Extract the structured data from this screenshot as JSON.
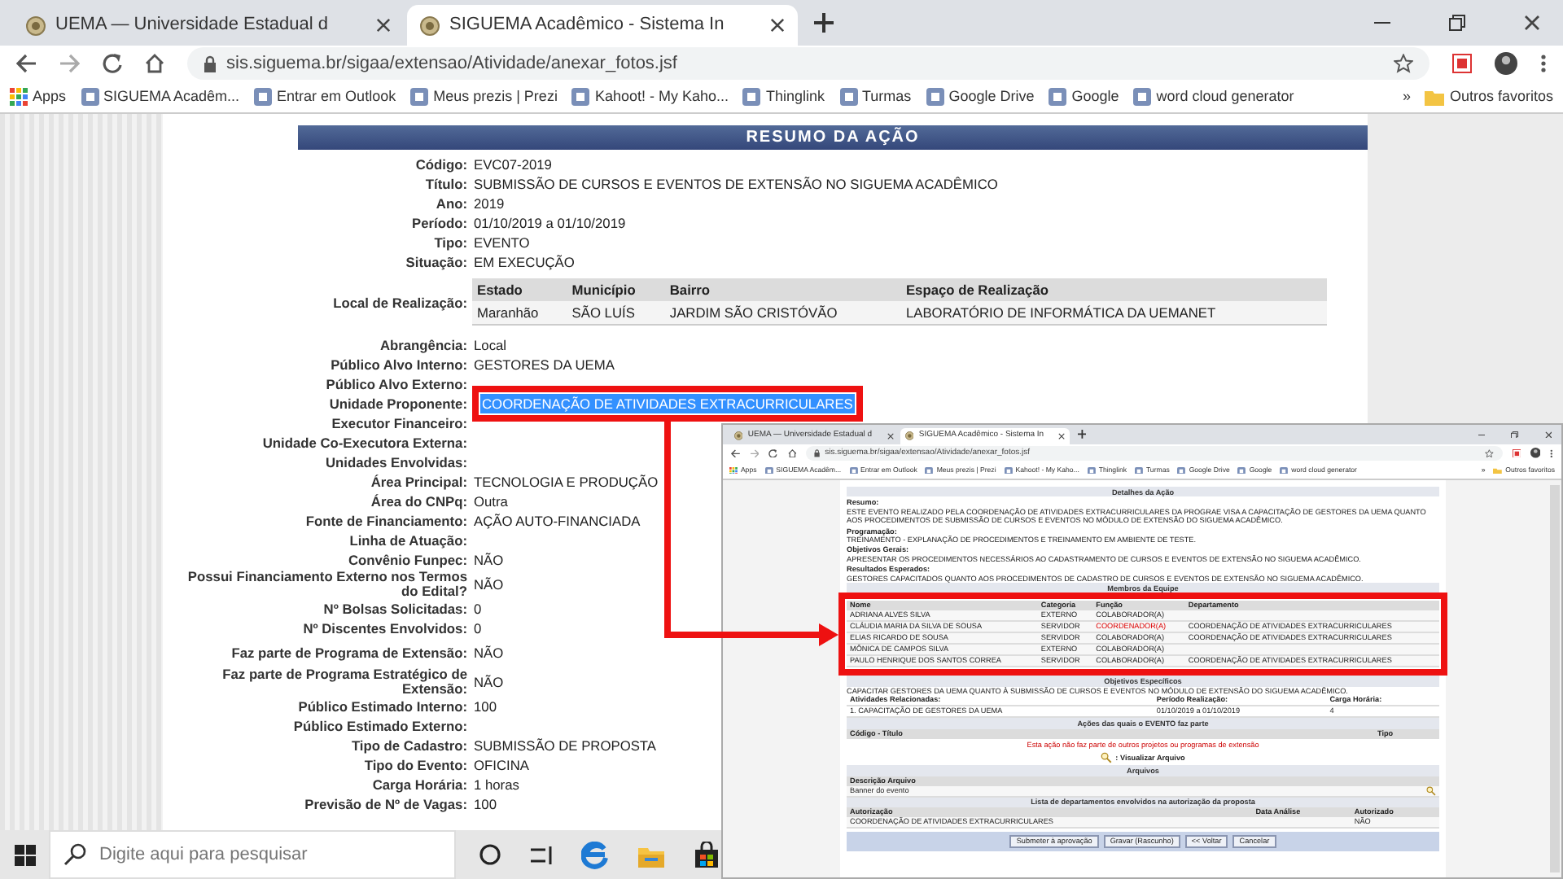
{
  "browser": {
    "tabs": [
      {
        "title": "UEMA — Universidade Estadual d",
        "selected": false
      },
      {
        "title": "SIGUEMA Acadêmico - Sistema In",
        "selected": true
      }
    ],
    "address": "sis.siguema.br/sigaa/extensao/Atividade/anexar_fotos.jsf",
    "bookmarks": [
      {
        "kind": "apps",
        "title": "Apps"
      },
      {
        "kind": "site",
        "title": "SIGUEMA Acadêm..."
      },
      {
        "kind": "site",
        "title": "Entrar em Outlook"
      },
      {
        "kind": "site",
        "title": "Meus prezis | Prezi"
      },
      {
        "kind": "site",
        "title": "Kahoot! - My Kaho..."
      },
      {
        "kind": "site",
        "title": "Thinglink"
      },
      {
        "kind": "site",
        "title": "Turmas"
      },
      {
        "kind": "site",
        "title": "Google Drive"
      },
      {
        "kind": "site",
        "title": "Google"
      },
      {
        "kind": "site",
        "title": "word cloud generator"
      }
    ],
    "bookmarks_more": "»",
    "other_bookmarks": "Outros favoritos"
  },
  "page": {
    "header": "RESUMO DA AÇÃO",
    "fields": [
      {
        "kind": "text",
        "label": "Código:",
        "value": "EVC07-2019",
        "highlighted": false
      },
      {
        "kind": "text",
        "label": "Título:",
        "value": "SUBMISSÃO DE CURSOS E EVENTOS DE EXTENSÃO NO SIGUEMA ACADÊMICO",
        "highlighted": false
      },
      {
        "kind": "text",
        "label": "Ano:",
        "value": "2019",
        "highlighted": false
      },
      {
        "kind": "text",
        "label": "Período:",
        "value": "01/10/2019 a 01/10/2019",
        "highlighted": false
      },
      {
        "kind": "text",
        "label": "Tipo:",
        "value": "EVENTO",
        "highlighted": false
      },
      {
        "kind": "text",
        "label": "Situação:",
        "value": "EM EXECUÇÃO",
        "highlighted": false
      },
      {
        "kind": "table",
        "label": "Local de Realização:",
        "columns": [
          "Estado",
          "Município",
          "Bairro",
          "Espaço de Realização"
        ],
        "rows": [
          [
            "Maranhão",
            "SÃO LUÍS",
            "JARDIM SÃO CRISTÓVÃO",
            "LABORATÓRIO DE INFORMÁTICA DA UEMANET"
          ]
        ],
        "highlighted": false
      },
      {
        "kind": "text",
        "label": "Abrangência:",
        "value": "Local",
        "highlighted": false
      },
      {
        "kind": "text",
        "label": "Público Alvo Interno:",
        "value": "GESTORES DA UEMA",
        "highlighted": false
      },
      {
        "kind": "text",
        "label": "Público Alvo Externo:",
        "highlighted": false
      },
      {
        "kind": "text",
        "label": "Unidade Proponente:",
        "value": "COORDENAÇÃO DE ATIVIDADES EXTRACURRICULARES",
        "highlighted": true
      },
      {
        "kind": "text",
        "label": "Executor Financeiro:",
        "highlighted": false
      },
      {
        "kind": "text",
        "label": "Unidade Co-Executora Externa:",
        "highlighted": false
      },
      {
        "kind": "text",
        "label": "Unidades Envolvidas:",
        "highlighted": false
      },
      {
        "kind": "text",
        "label": "Área Principal:",
        "value": "TECNOLOGIA E PRODUÇÃO",
        "highlighted": false
      },
      {
        "kind": "text",
        "label": "Área do CNPq:",
        "value": "Outra",
        "highlighted": false
      },
      {
        "kind": "text",
        "label": "Fonte de Financiamento:",
        "value": "AÇÃO AUTO-FINANCIADA",
        "highlighted": false
      },
      {
        "kind": "text",
        "label": "Linha de Atuação:",
        "highlighted": false
      },
      {
        "kind": "text",
        "label": "Convênio Funpec:",
        "value": "NÃO",
        "highlighted": false
      },
      {
        "kind": "text",
        "label": "Possui Financiamento Externo nos Termos do Edital?",
        "value": "NÃO",
        "highlighted": false
      },
      {
        "kind": "text",
        "label": "Nº Bolsas Solicitadas:",
        "value": "0",
        "highlighted": false
      },
      {
        "kind": "text",
        "label": "Nº Discentes Envolvidos:",
        "value": "0",
        "highlighted": false
      },
      {
        "kind": "text",
        "label": "Faz parte de Programa de Extensão:",
        "value": "NÃO",
        "highlighted": false
      },
      {
        "kind": "text",
        "label": "Faz parte de Programa Estratégico de Extensão:",
        "value": "NÃO",
        "highlighted": false
      },
      {
        "kind": "text",
        "label": "Público Estimado Interno:",
        "value": "100",
        "highlighted": false
      },
      {
        "kind": "text",
        "label": "Público Estimado Externo:",
        "highlighted": false
      },
      {
        "kind": "text",
        "label": "Tipo de Cadastro:",
        "value": "SUBMISSÃO DE PROPOSTA",
        "highlighted": false
      },
      {
        "kind": "text",
        "label": "Tipo do Evento:",
        "value": "OFICINA",
        "highlighted": false
      },
      {
        "kind": "text",
        "label": "Carga Horária:",
        "value": "1 horas",
        "highlighted": false
      },
      {
        "kind": "text",
        "label": "Previsão de Nº de Vagas:",
        "value": "100",
        "highlighted": false
      }
    ]
  },
  "inset": {
    "tabs": [
      {
        "title": "UEMA — Universidade Estadual d",
        "selected": false
      },
      {
        "title": "SIGUEMA Acadêmico - Sistema In",
        "selected": true
      }
    ],
    "address": "sis.siguema.br/sigaa/extensao/Atividade/anexar_fotos.jsf",
    "bookmarks": [
      {
        "kind": "apps",
        "title": "Apps"
      },
      {
        "kind": "site",
        "title": "SIGUEMA Acadêm..."
      },
      {
        "kind": "site",
        "title": "Entrar em Outlook"
      },
      {
        "kind": "site",
        "title": "Meus prezis | Prezi"
      },
      {
        "kind": "site",
        "title": "Kahoot! - My Kaho..."
      },
      {
        "kind": "site",
        "title": "Thinglink"
      },
      {
        "kind": "site",
        "title": "Turmas"
      },
      {
        "kind": "site",
        "title": "Google Drive"
      },
      {
        "kind": "site",
        "title": "Google"
      },
      {
        "kind": "site",
        "title": "word cloud generator"
      }
    ],
    "bookmarks_more": "»",
    "other_bookmarks": "Outros favoritos",
    "details_title": "Detalhes da Ação",
    "details": [
      {
        "label": "Resumo:",
        "text": "ESTE EVENTO REALIZADO PELA COORDENAÇÃO DE ATIVIDADES EXTRACURRICULARES DA PROGRAE VISA A CAPACITAÇÃO DE GESTORES DA UEMA QUANTO AOS PROCEDIMENTOS DE SUBMISSÃO DE CURSOS E EVENTOS NO MÓDULO DE EXTENSÃO DO SIGUEMA ACADÊMICO."
      },
      {
        "label": "Programação:",
        "text": "TREINAMENTO - EXPLANAÇÃO DE PROCEDIMENTOS E TREINAMENTO EM AMBIENTE DE TESTE."
      },
      {
        "label": "Objetivos Gerais:",
        "text": "APRESENTAR OS PROCEDIMENTOS NECESSÁRIOS AO CADASTRAMENTO DE CURSOS E EVENTOS DE EXTENSÃO NO SIGUEMA ACADÊMICO."
      },
      {
        "label": "Resultados Esperados:",
        "text": "GESTORES CAPACITADOS QUANTO AOS PROCEDIMENTOS DE CADASTRO DE CURSOS E EVENTOS DE EXTENSÃO NO SIGUEMA ACADÊMICO."
      }
    ],
    "team": {
      "title": "Membros da Equipe",
      "columns": [
        "Nome",
        "Categoria",
        "Função",
        "Departamento"
      ],
      "rows": [
        {
          "name": "ADRIANA ALVES SILVA",
          "category": "EXTERNO",
          "role": "COLABORADOR(A)",
          "coordinator": false
        },
        {
          "name": "CLÁUDIA MARIA DA SILVA DE SOUSA",
          "category": "SERVIDOR",
          "role": "COORDENADOR(A)",
          "department": "COORDENAÇÃO DE ATIVIDADES EXTRACURRICULARES",
          "coordinator": true
        },
        {
          "name": "ELIAS RICARDO DE SOUSA",
          "category": "SERVIDOR",
          "role": "COLABORADOR(A)",
          "department": "COORDENAÇÃO DE ATIVIDADES EXTRACURRICULARES",
          "coordinator": false
        },
        {
          "name": "MÔNICA DE CAMPOS SILVA",
          "category": "EXTERNO",
          "role": "COLABORADOR(A)",
          "coordinator": false
        },
        {
          "name": "PAULO HENRIQUE DOS SANTOS CORREA",
          "category": "SERVIDOR",
          "role": "COLABORADOR(A)",
          "department": "COORDENAÇÃO DE ATIVIDADES EXTRACURRICULARES",
          "coordinator": false
        }
      ]
    },
    "objectives": {
      "title": "Objetivos Específicos",
      "text": "CAPACITAR GESTORES DA UEMA QUANTO À SUBMISSÃO DE CURSOS E EVENTOS NO MÓDULO DE EXTENSÃO DO SIGUEMA ACADÊMICO."
    },
    "activities": {
      "columns": [
        "Atividades Relacionadas:",
        "Período Realização:",
        "Carga Horária:"
      ],
      "row": [
        "1. CAPACITAÇÃO DE GESTORES DA UEMA",
        "01/10/2019 a 01/10/2019",
        "4"
      ]
    },
    "actions": {
      "title": "Ações das quais o EVENTO faz parte",
      "columns": [
        "Código - Título",
        "Tipo"
      ],
      "message": "Esta ação não faz parte de outros projetos ou programas de extensão"
    },
    "view_file": ": Visualizar Arquivo",
    "files": {
      "title": "Arquivos",
      "column": "Descrição Arquivo",
      "row": "Banner do evento"
    },
    "departments": {
      "title": "Lista de departamentos envolvidos na autorização da proposta",
      "columns": [
        "Autorização",
        "Data Análise",
        "Autorizado"
      ],
      "row": {
        "authorization": "COORDENAÇÃO DE ATIVIDADES EXTRACURRICULARES",
        "authorized": "NÃO"
      }
    },
    "buttons": [
      "Submeter à aprovação",
      "Gravar (Rascunho)",
      "<< Voltar",
      "Cancelar"
    ]
  },
  "taskbar": {
    "search_placeholder": "Digite aqui para pesquisar"
  }
}
